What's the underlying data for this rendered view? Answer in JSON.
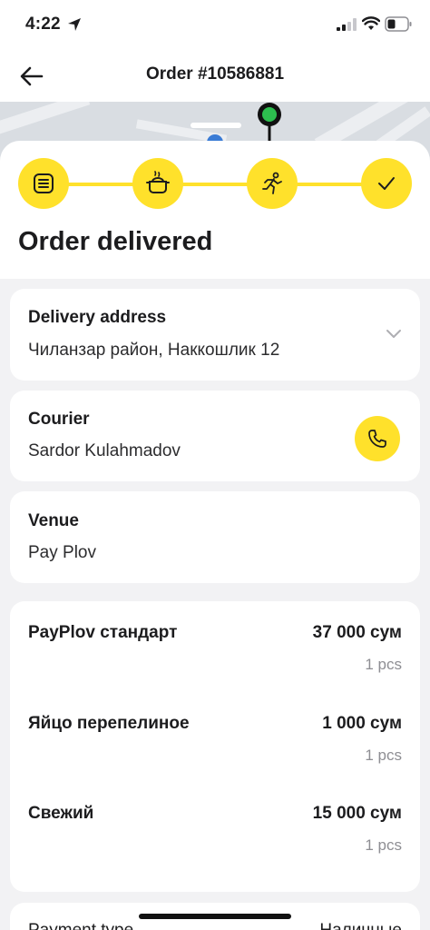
{
  "status_bar": {
    "time": "4:22"
  },
  "nav": {
    "title": "Order #10586881"
  },
  "order_status": {
    "title": "Order delivered",
    "steps": [
      "list-icon",
      "cooking-pot-icon",
      "running-courier-icon",
      "checkmark-icon"
    ],
    "accent": "#ffe12b"
  },
  "delivery": {
    "label": "Delivery address",
    "value": "Чиланзар район, Наккошлик 12"
  },
  "courier": {
    "label": "Courier",
    "value": "Sardor Kulahmadov"
  },
  "venue": {
    "label": "Venue",
    "value": "Pay Plov"
  },
  "items": [
    {
      "name": "PayPlov  стандарт",
      "price": "37 000 сум",
      "qty": "1 pcs"
    },
    {
      "name": "Яйцо перепелиное",
      "price": "1 000 сум",
      "qty": "1 pcs"
    },
    {
      "name": "Свежий",
      "price": "15 000 сум",
      "qty": "1 pcs"
    }
  ],
  "payment": {
    "label": "Payment type",
    "value": "Наличные"
  }
}
